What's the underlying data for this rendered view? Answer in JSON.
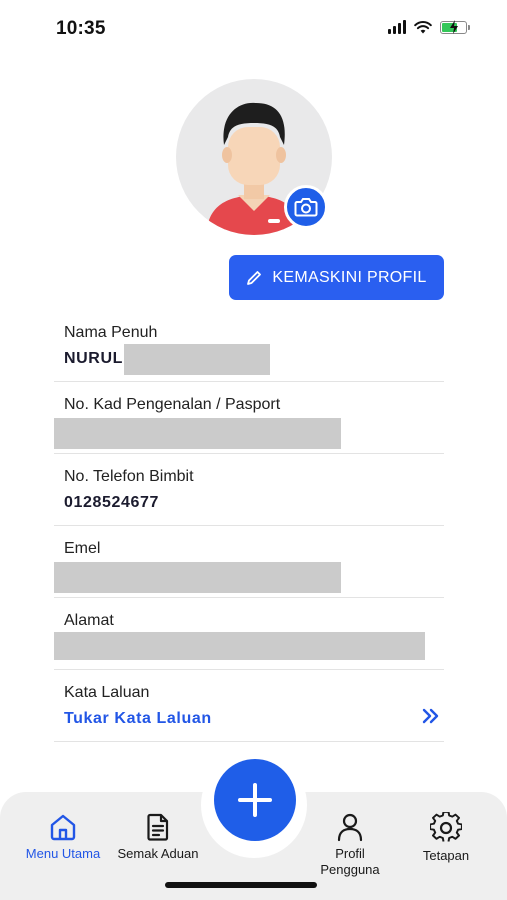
{
  "status_bar": {
    "time": "10:35"
  },
  "profile": {
    "update_button_label": "KEMASKINI PROFIL"
  },
  "fields": [
    {
      "label": "Nama Penuh",
      "value": "NURUL"
    },
    {
      "label": "No. Kad Pengenalan / Pasport",
      "value": ""
    },
    {
      "label": "No. Telefon Bimbit",
      "value": "0128524677"
    },
    {
      "label": "Emel",
      "value": ""
    },
    {
      "label": "Alamat",
      "value": ""
    },
    {
      "label": "Kata Laluan",
      "value": "Tukar Kata Laluan"
    }
  ],
  "nav": {
    "items": [
      {
        "label": "Menu Utama",
        "icon": "home-icon",
        "active": true
      },
      {
        "label": "Semak Aduan",
        "icon": "document-icon",
        "active": false
      },
      {
        "label": "Profil Pengguna",
        "icon": "user-icon",
        "active": false
      },
      {
        "label": "Tetapan",
        "icon": "gear-icon",
        "active": false
      }
    ]
  },
  "colors": {
    "accent": "#2a5ff0",
    "link": "#2256e6",
    "redaction": "#cbcbcb"
  }
}
